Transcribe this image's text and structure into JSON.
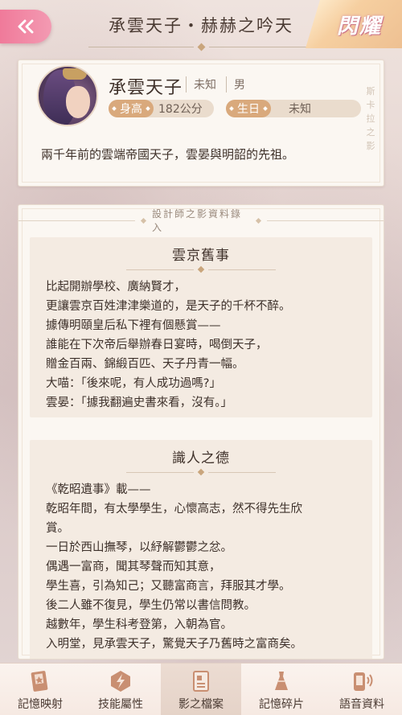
{
  "header": {
    "title": "承雲天子・赫赫之吟天",
    "badge": "閃耀",
    "back_icon": "back-chevron-icon"
  },
  "profile": {
    "name": "承雲天子",
    "tag1": "未知",
    "tag2": "男",
    "height_label": "身高",
    "height_value": "182公分",
    "birthday_label": "生日",
    "birthday_value": "未知",
    "side_text": "斯卡拉之影",
    "description": "兩千年前的雲端帝國天子，雲晏與明韶的先祖。"
  },
  "records": {
    "title": "設計師之影資料錄入",
    "sections": [
      {
        "title": "雲京舊事",
        "lines": [
          "比起開辦學校、廣納賢才，",
          "更讓雲京百姓津津樂道的，是天子的千杯不醉。",
          "據傳明頤皇后私下裡有個懸賞——",
          "誰能在下次帝后舉辦春日宴時，喝倒天子，",
          "贈金百兩、錦緞百匹、天子丹青一幅。",
          "大喵：「後來呢，有人成功過嗎?」",
          "雲晏：「據我翻遍史書來看，沒有。」"
        ]
      },
      {
        "title": "識人之德",
        "lines": [
          "《乾昭遺事》載——",
          "乾昭年間，有太學學生，心懷高志，然不得先生欣",
          "賞。",
          "一日於西山撫琴，以紓解鬱鬱之忿。",
          "偶遇一富商，聞其琴聲而知其意，",
          "學生喜，引為知己；又聽富商言，拜服其才學。",
          "後二人雖不復見，學生仍常以書信問教。",
          "越數年，學生科考登第，入朝為官。",
          "入明堂，見承雲天子，驚覺天子乃舊時之富商矣。"
        ]
      }
    ]
  },
  "nav": {
    "items": [
      {
        "label": "記憶映射",
        "icon": "memory-card-icon",
        "active": false
      },
      {
        "label": "技能屬性",
        "icon": "skill-lightning-icon",
        "active": false
      },
      {
        "label": "影之檔案",
        "icon": "profile-file-icon",
        "active": true
      },
      {
        "label": "記憶碎片",
        "icon": "dress-fragment-icon",
        "active": false
      },
      {
        "label": "語音資料",
        "icon": "voice-phone-icon",
        "active": false
      }
    ]
  },
  "colors": {
    "accent_pink": "#f07a9a",
    "pill_gold": "#d9a97c",
    "text_dark": "#3f312a"
  }
}
